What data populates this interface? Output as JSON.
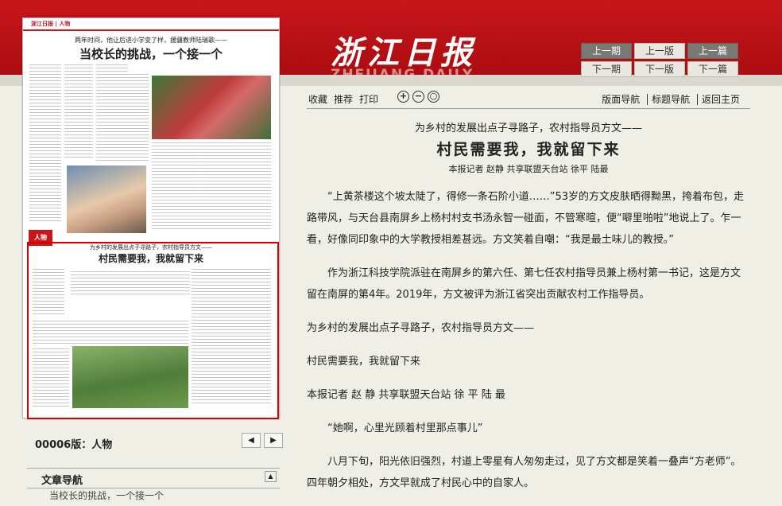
{
  "masthead": {
    "logo_cn": "浙江日报",
    "logo_en": "ZHEJIANG DAILY"
  },
  "nav_buttons": [
    "上一期",
    "上一版",
    "上一篇",
    "下一期",
    "下一版",
    "下一篇"
  ],
  "toolbar": {
    "favorite": "收藏",
    "recommend": "推荐",
    "print": "打印",
    "zoom_in": "+",
    "zoom_out": "−",
    "zoom_reset": "○",
    "layout_nav": "版面导航",
    "title_nav": "标题导航",
    "home": "返回主页"
  },
  "newspaper": {
    "label": "浙江日报 | 人物",
    "top_kicker": "两年时间，他让后进小学变了样，援疆教师陆瑞歌——",
    "top_headline": "当校长的挑战，一个接一个",
    "section_tag": "人物",
    "article_kicker": "为乡村的发展出点子寻路子，农村指导员方文——",
    "article_headline": "村民需要我，我就留下来"
  },
  "article": {
    "subtitle": "为乡村的发展出点子寻路子，农村指导员方文——",
    "title": "村民需要我，我就留下来",
    "byline": "本报记者 赵静 共享联盟天台站 徐平 陆最",
    "paragraphs": [
      {
        "text": "“上黄茶楼这个坡太陡了，得修一条石阶小道……”53岁的方文皮肤晒得黝黑，挎着布包，走路带风，与天台县南屏乡上杨村村支书汤永智一碰面，不管寒暄，便“噼里啪啦”地说上了。乍一看，好像同印象中的大学教授相差甚远。方文笑着自嘲：“我是最土味儿的教授。”",
        "indent": true
      },
      {
        "text": "作为浙江科技学院派驻在南屏乡的第六任、第七任农村指导员兼上杨村第一书记，这是方文留在南屏的第4年。2019年，方文被评为浙江省突出贡献农村工作指导员。",
        "indent": true
      },
      {
        "text": "为乡村的发展出点子寻路子，农村指导员方文——",
        "indent": false
      },
      {
        "text": "村民需要我，我就留下来",
        "indent": false
      },
      {
        "text": "本报记者 赵 静 共享联盟天台站 徐 平 陆 最",
        "indent": false
      },
      {
        "text": "“她啊，心里光顾着村里那点事儿”",
        "indent": true
      },
      {
        "text": "八月下旬，阳光依旧强烈，村道上零星有人匆匆走过，见了方文都是笑着一叠声“方老师”。四年朝夕相处，方文早就成了村民心中的自家人。",
        "indent": true
      }
    ]
  },
  "sidebar": {
    "edition": "00006版：人物",
    "prev": "◀",
    "next": "▶",
    "section_title": "文章导航",
    "collapse": "▲",
    "nav_item": "当校长的挑战，一个接一个"
  }
}
